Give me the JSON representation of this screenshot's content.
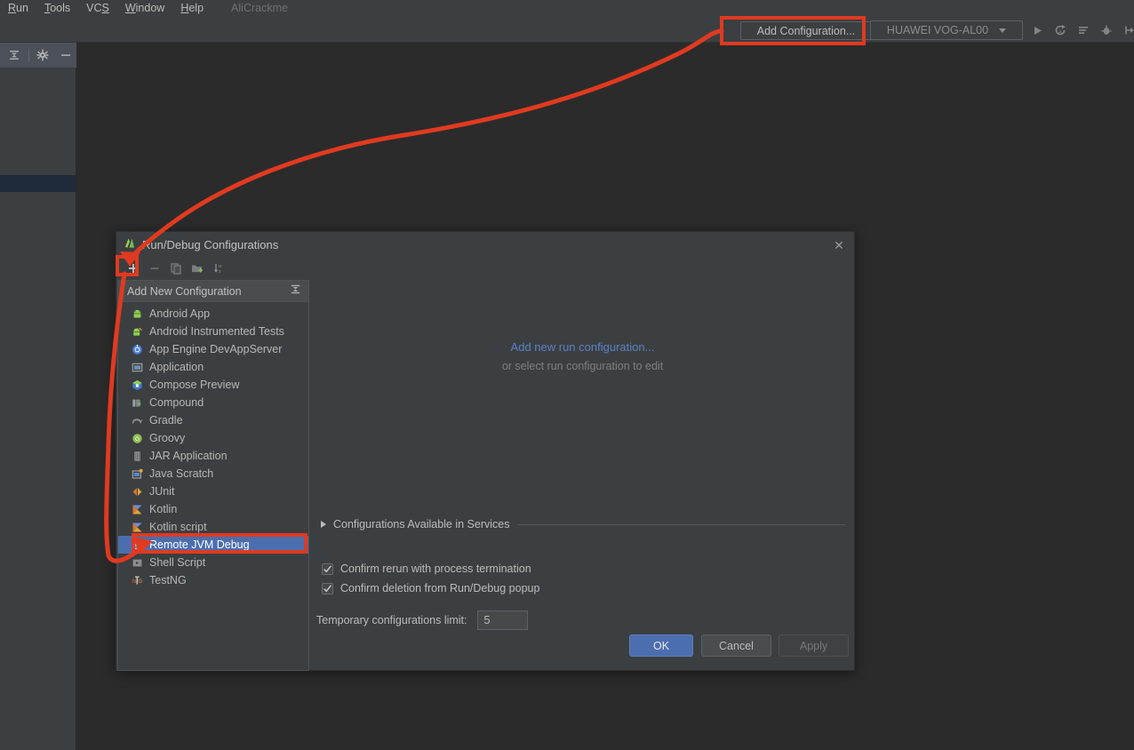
{
  "menubar": {
    "items": [
      {
        "label": "Run",
        "mnemonic": "R"
      },
      {
        "label": "Tools",
        "mnemonic": "T"
      },
      {
        "label": "VCS",
        "mnemonic": "S"
      },
      {
        "label": "Window",
        "mnemonic": "W"
      },
      {
        "label": "Help",
        "mnemonic": "H"
      }
    ],
    "project_name": "AliCrackme"
  },
  "toolbar": {
    "add_configuration_label": "Add Configuration...",
    "device_label": "HUAWEI VOG-AL00",
    "icons": [
      "run-icon",
      "apply-changes-icon",
      "run-with-coverage-icon",
      "debug-icon",
      "attach-debugger-icon"
    ]
  },
  "left_panel": {
    "icons": [
      "collapse-all-icon",
      "settings-gear-icon",
      "hide-panel-icon"
    ]
  },
  "dialog": {
    "title": "Run/Debug Configurations",
    "close_label": "✕",
    "toolbar_icons": [
      "add-icon",
      "remove-icon",
      "copy-icon",
      "new-folder-icon",
      "sort-alphabetically-icon"
    ],
    "list_header": "Add New Configuration",
    "list_collapse_icon": "collapse-all-icon",
    "configurations": [
      {
        "label": "Android App",
        "icon": "android-icon"
      },
      {
        "label": "Android Instrumented Tests",
        "icon": "android-test-icon"
      },
      {
        "label": "App Engine DevAppServer",
        "icon": "app-engine-icon"
      },
      {
        "label": "Application",
        "icon": "application-icon"
      },
      {
        "label": "Compose Preview",
        "icon": "compose-icon"
      },
      {
        "label": "Compound",
        "icon": "compound-icon"
      },
      {
        "label": "Gradle",
        "icon": "gradle-icon"
      },
      {
        "label": "Groovy",
        "icon": "groovy-icon"
      },
      {
        "label": "JAR Application",
        "icon": "jar-icon"
      },
      {
        "label": "Java Scratch",
        "icon": "java-scratch-icon"
      },
      {
        "label": "JUnit",
        "icon": "junit-icon"
      },
      {
        "label": "Kotlin",
        "icon": "kotlin-icon"
      },
      {
        "label": "Kotlin script",
        "icon": "kotlin-script-icon"
      },
      {
        "label": "Remote JVM Debug",
        "icon": "remote-debug-icon",
        "selected": true
      },
      {
        "label": "Shell Script",
        "icon": "shell-script-icon"
      },
      {
        "label": "TestNG",
        "icon": "testng-icon"
      }
    ],
    "empty_state": {
      "link": "Add new run configuration...",
      "subtitle": "or select run configuration to edit"
    },
    "services_section": "Configurations Available in Services",
    "checkboxes": [
      {
        "label": "Confirm rerun with process termination",
        "checked": true
      },
      {
        "label": "Confirm deletion from Run/Debug popup",
        "checked": true
      }
    ],
    "temp_limit": {
      "label": "Temporary configurations limit:",
      "value": "5"
    },
    "buttons": {
      "ok": "OK",
      "cancel": "Cancel",
      "apply": "Apply"
    }
  },
  "annotations": {
    "accent_color": "#e03a20",
    "highlighted": [
      "add-configuration-button",
      "add-configuration-plus-button",
      "remote-jvm-debug-row"
    ]
  }
}
